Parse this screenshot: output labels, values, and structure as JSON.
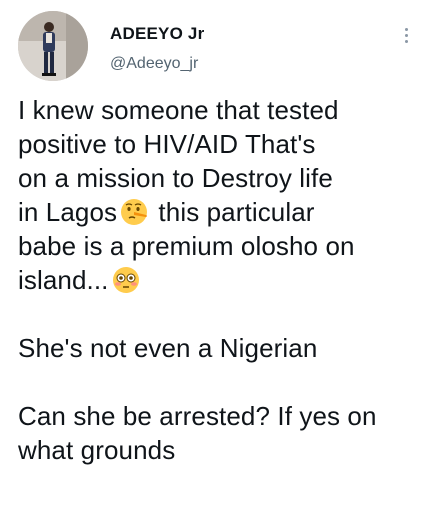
{
  "author": {
    "display_name": "ADEEYO Jr",
    "handle": "@Adeeyo_jr"
  },
  "icons": {
    "more": "more-vertical-icon",
    "emoji_lying": "lying-face-emoji-icon",
    "emoji_flushed": "flushed-face-emoji-icon"
  },
  "tweet": {
    "line1": "I knew someone that tested",
    "line2": "positive to HIV/AID That's",
    "line3": "on a mission to Destroy life",
    "line4a": "in Lagos",
    "line4b": " this particular",
    "line5": "babe is a premium olosho on",
    "line6a": "island...",
    "para2": "She's not even a Nigerian",
    "para3_line1": "Can she be arrested? If yes on",
    "para3_line2": "what grounds"
  },
  "colors": {
    "text": "#0f1419",
    "secondary": "#536471",
    "emoji": "#ffcc4d"
  }
}
